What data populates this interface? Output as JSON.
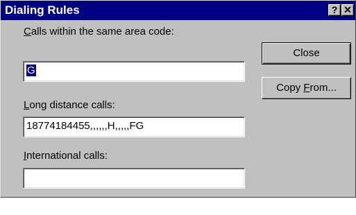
{
  "window": {
    "title": "Dialing Rules",
    "help_glyph": "?",
    "close_glyph": "✕"
  },
  "fields": {
    "local": {
      "label_accel": "C",
      "label_rest": "alls within the same area code:",
      "value": "G"
    },
    "long_distance": {
      "label_accel": "L",
      "label_rest": "ong distance calls:",
      "value": "18774184455,,,,,,H,,,,,FG"
    },
    "international": {
      "label_accel": "I",
      "label_rest": "nternational calls:",
      "value": ""
    }
  },
  "buttons": {
    "close_label": "Close",
    "copy_from_prefix": "Copy ",
    "copy_from_accel": "F",
    "copy_from_suffix": "rom..."
  }
}
